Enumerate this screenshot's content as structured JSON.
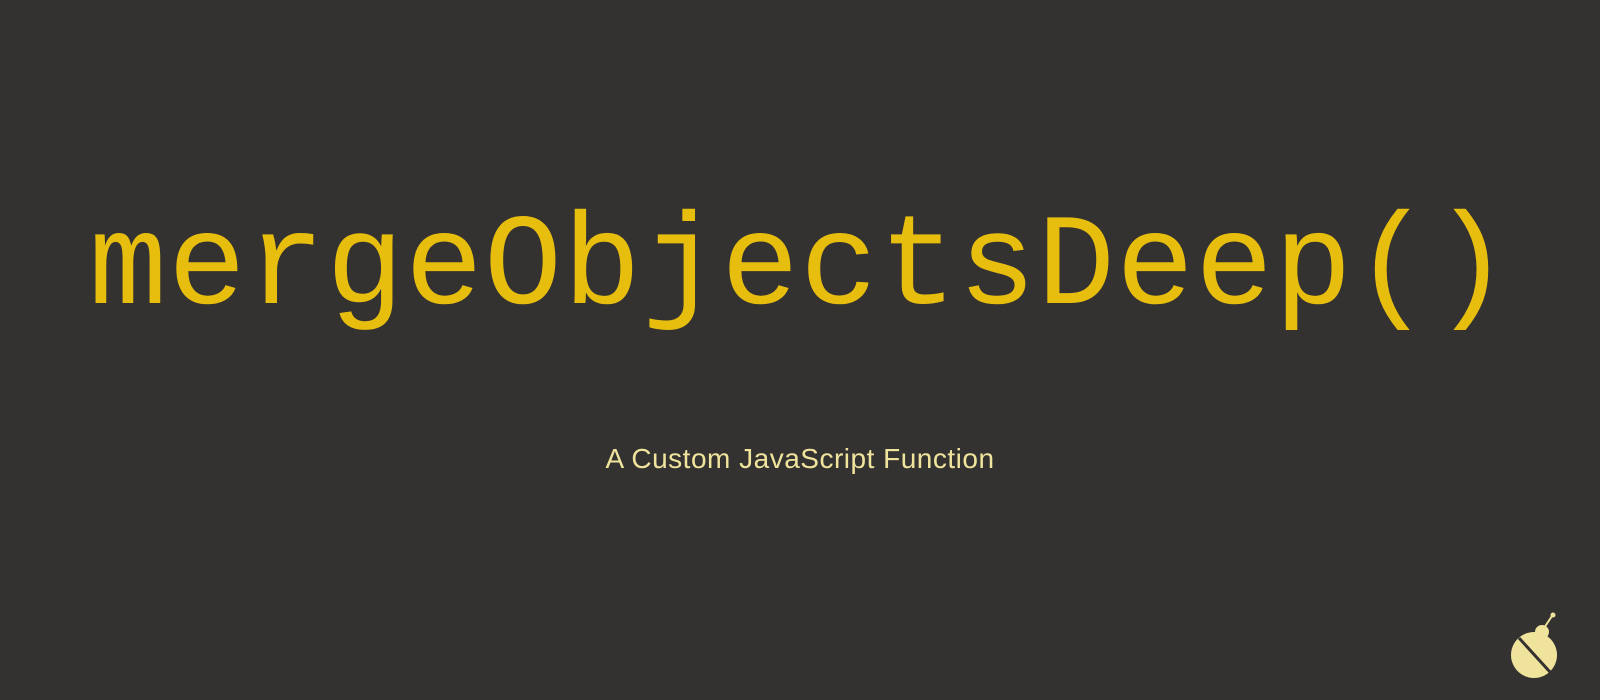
{
  "title": "mergeObjectsDeep()",
  "subtitle": "A  Custom JavaScript Function",
  "colors": {
    "background": "#333231",
    "title": "#e8be0e",
    "subtitle": "#f0e49d",
    "logo": "#f0e49d"
  }
}
